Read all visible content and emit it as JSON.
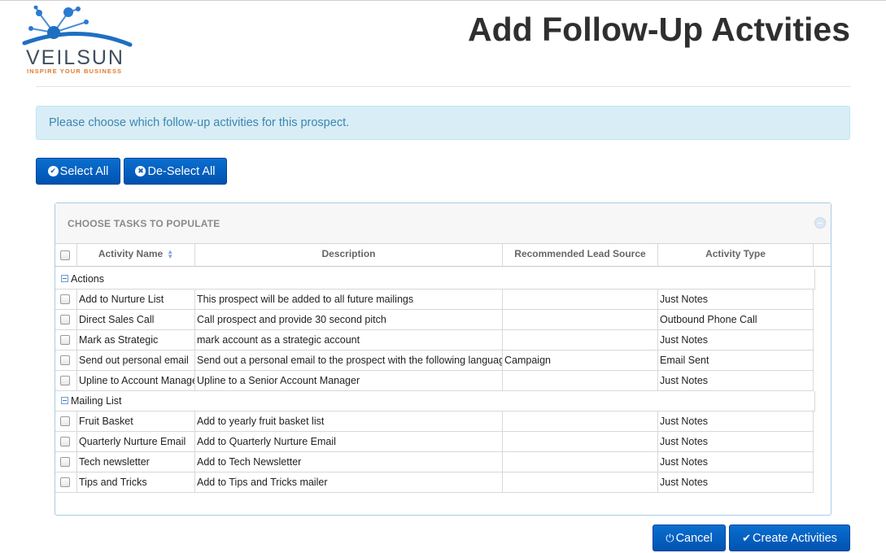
{
  "brand": {
    "logo_word": "VEILSUN",
    "tagline": "INSPIRE YOUR BUSINESS",
    "colors": {
      "logo_blue": "#1f6fc1",
      "logo_text": "#3f4f5f",
      "tagline": "#e07a2a"
    }
  },
  "page": {
    "title": "Add Follow-Up Actvities",
    "info_message": "Please choose which follow-up activities for this prospect."
  },
  "toolbar": {
    "select_all_label": "Select All",
    "deselect_all_label": "De-Select All"
  },
  "panel": {
    "title": "CHOOSE TASKS TO POPULATE"
  },
  "grid": {
    "columns": [
      "Activity Name",
      "Description",
      "Recommended Lead Source",
      "Activity Type"
    ],
    "groups": [
      {
        "name": "Actions",
        "rows": [
          {
            "name": "Add to Nurture List",
            "description": "This prospect will be added to all future mailings",
            "lead_source": "",
            "type": "Just Notes"
          },
          {
            "name": "Direct Sales Call",
            "description": "Call prospect and provide 30 second pitch",
            "lead_source": "",
            "type": "Outbound Phone Call"
          },
          {
            "name": "Mark as Strategic",
            "description": "mark account as a strategic account",
            "lead_source": "",
            "type": "Just Notes"
          },
          {
            "name": "Send out personal email",
            "description": "Send out a personal email to the prospect with the following languag",
            "lead_source": "Campaign",
            "type": "Email Sent"
          },
          {
            "name": "Upline to Account Manage",
            "description": "Upline to a Senior Account Manager",
            "lead_source": "",
            "type": "Just Notes"
          }
        ]
      },
      {
        "name": "Mailing List",
        "rows": [
          {
            "name": "Fruit Basket",
            "description": "Add to yearly fruit basket list",
            "lead_source": "",
            "type": "Just Notes"
          },
          {
            "name": "Quarterly Nurture Email",
            "description": "Add to Quarterly Nurture Email",
            "lead_source": "",
            "type": "Just Notes"
          },
          {
            "name": "Tech newsletter",
            "description": "Add to Tech Newsletter",
            "lead_source": "",
            "type": "Just Notes"
          },
          {
            "name": "Tips and Tricks",
            "description": "Add to Tips and Tricks mailer",
            "lead_source": "",
            "type": "Just Notes"
          }
        ]
      }
    ]
  },
  "footer": {
    "cancel_label": "Cancel",
    "create_label": "Create Activities"
  },
  "icons": {
    "select_all": "check-circle-icon",
    "deselect_all": "x-circle-icon",
    "cancel": "power-icon",
    "create": "checkmark-icon",
    "sort": "sort-icon",
    "group_toggle": "minus-square-icon",
    "panel_toggle": "collapse-icon"
  }
}
